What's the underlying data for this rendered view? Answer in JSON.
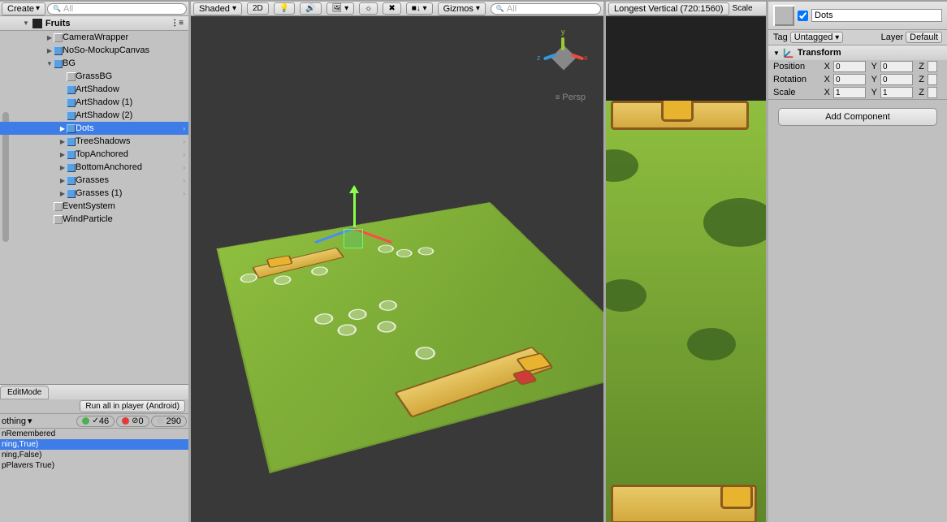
{
  "hierarchy": {
    "create_label": "Create",
    "search_placeholder": "All",
    "root_name": "Fruits",
    "items": [
      {
        "name": "CameraWrapper",
        "indent": 1,
        "expand": true,
        "prefab": false
      },
      {
        "name": "NoSo-MockupCanvas",
        "indent": 1,
        "expand": true,
        "prefab": true
      },
      {
        "name": "BG",
        "indent": 1,
        "expand": true,
        "expanded": true,
        "prefab": true
      },
      {
        "name": "GrassBG",
        "indent": 2,
        "expand": false,
        "prefab": false
      },
      {
        "name": "ArtShadow",
        "indent": 2,
        "expand": false,
        "prefab": true
      },
      {
        "name": "ArtShadow (1)",
        "indent": 2,
        "expand": false,
        "prefab": true
      },
      {
        "name": "ArtShadow (2)",
        "indent": 2,
        "expand": false,
        "prefab": true
      },
      {
        "name": "Dots",
        "indent": 2,
        "expand": true,
        "prefab": true,
        "selected": true,
        "more": true
      },
      {
        "name": "TreeShadows",
        "indent": 2,
        "expand": true,
        "prefab": true,
        "more": true
      },
      {
        "name": "TopAnchored",
        "indent": 2,
        "expand": true,
        "prefab": true,
        "more": true
      },
      {
        "name": "BottomAnchored",
        "indent": 2,
        "expand": true,
        "prefab": true,
        "more": true
      },
      {
        "name": "Grasses",
        "indent": 2,
        "expand": true,
        "prefab": true,
        "more": true
      },
      {
        "name": "Grasses (1)",
        "indent": 2,
        "expand": true,
        "prefab": true,
        "more": true
      },
      {
        "name": "EventSystem",
        "indent": 1,
        "expand": false,
        "prefab": false
      },
      {
        "name": "WindParticle",
        "indent": 1,
        "expand": false,
        "prefab": false
      }
    ]
  },
  "scene_toolbar": {
    "shaded": "Shaded",
    "twod": "2D",
    "gizmos": "Gizmos",
    "search_placeholder": "All",
    "persp": "Persp",
    "axis_y": "y",
    "axis_x": "x",
    "axis_z": "z"
  },
  "game_toolbar": {
    "aspect": "Longest Vertical (720:1560)",
    "scale": "Scale"
  },
  "inspector": {
    "name": "Dots",
    "tag_label": "Tag",
    "tag_value": "Untagged",
    "layer_label": "Layer",
    "layer_value": "Default",
    "transform": {
      "title": "Transform",
      "position_label": "Position",
      "rotation_label": "Rotation",
      "scale_label": "Scale",
      "position": {
        "x": "0",
        "y": "0",
        "z": ""
      },
      "rotation": {
        "x": "0",
        "y": "0",
        "z": ""
      },
      "scale": {
        "x": "1",
        "y": "1",
        "z": ""
      }
    },
    "add_component": "Add Component"
  },
  "tests": {
    "editmode_tab": "EditMode",
    "run_label": "Run all in player (Android)",
    "filter_nothing": "othing",
    "pass_count": "46",
    "fail_count": "0",
    "skip_count": "290",
    "rows": [
      "nRemembered",
      "ning,True)",
      "ning,False)",
      "pPlavers True)"
    ]
  }
}
